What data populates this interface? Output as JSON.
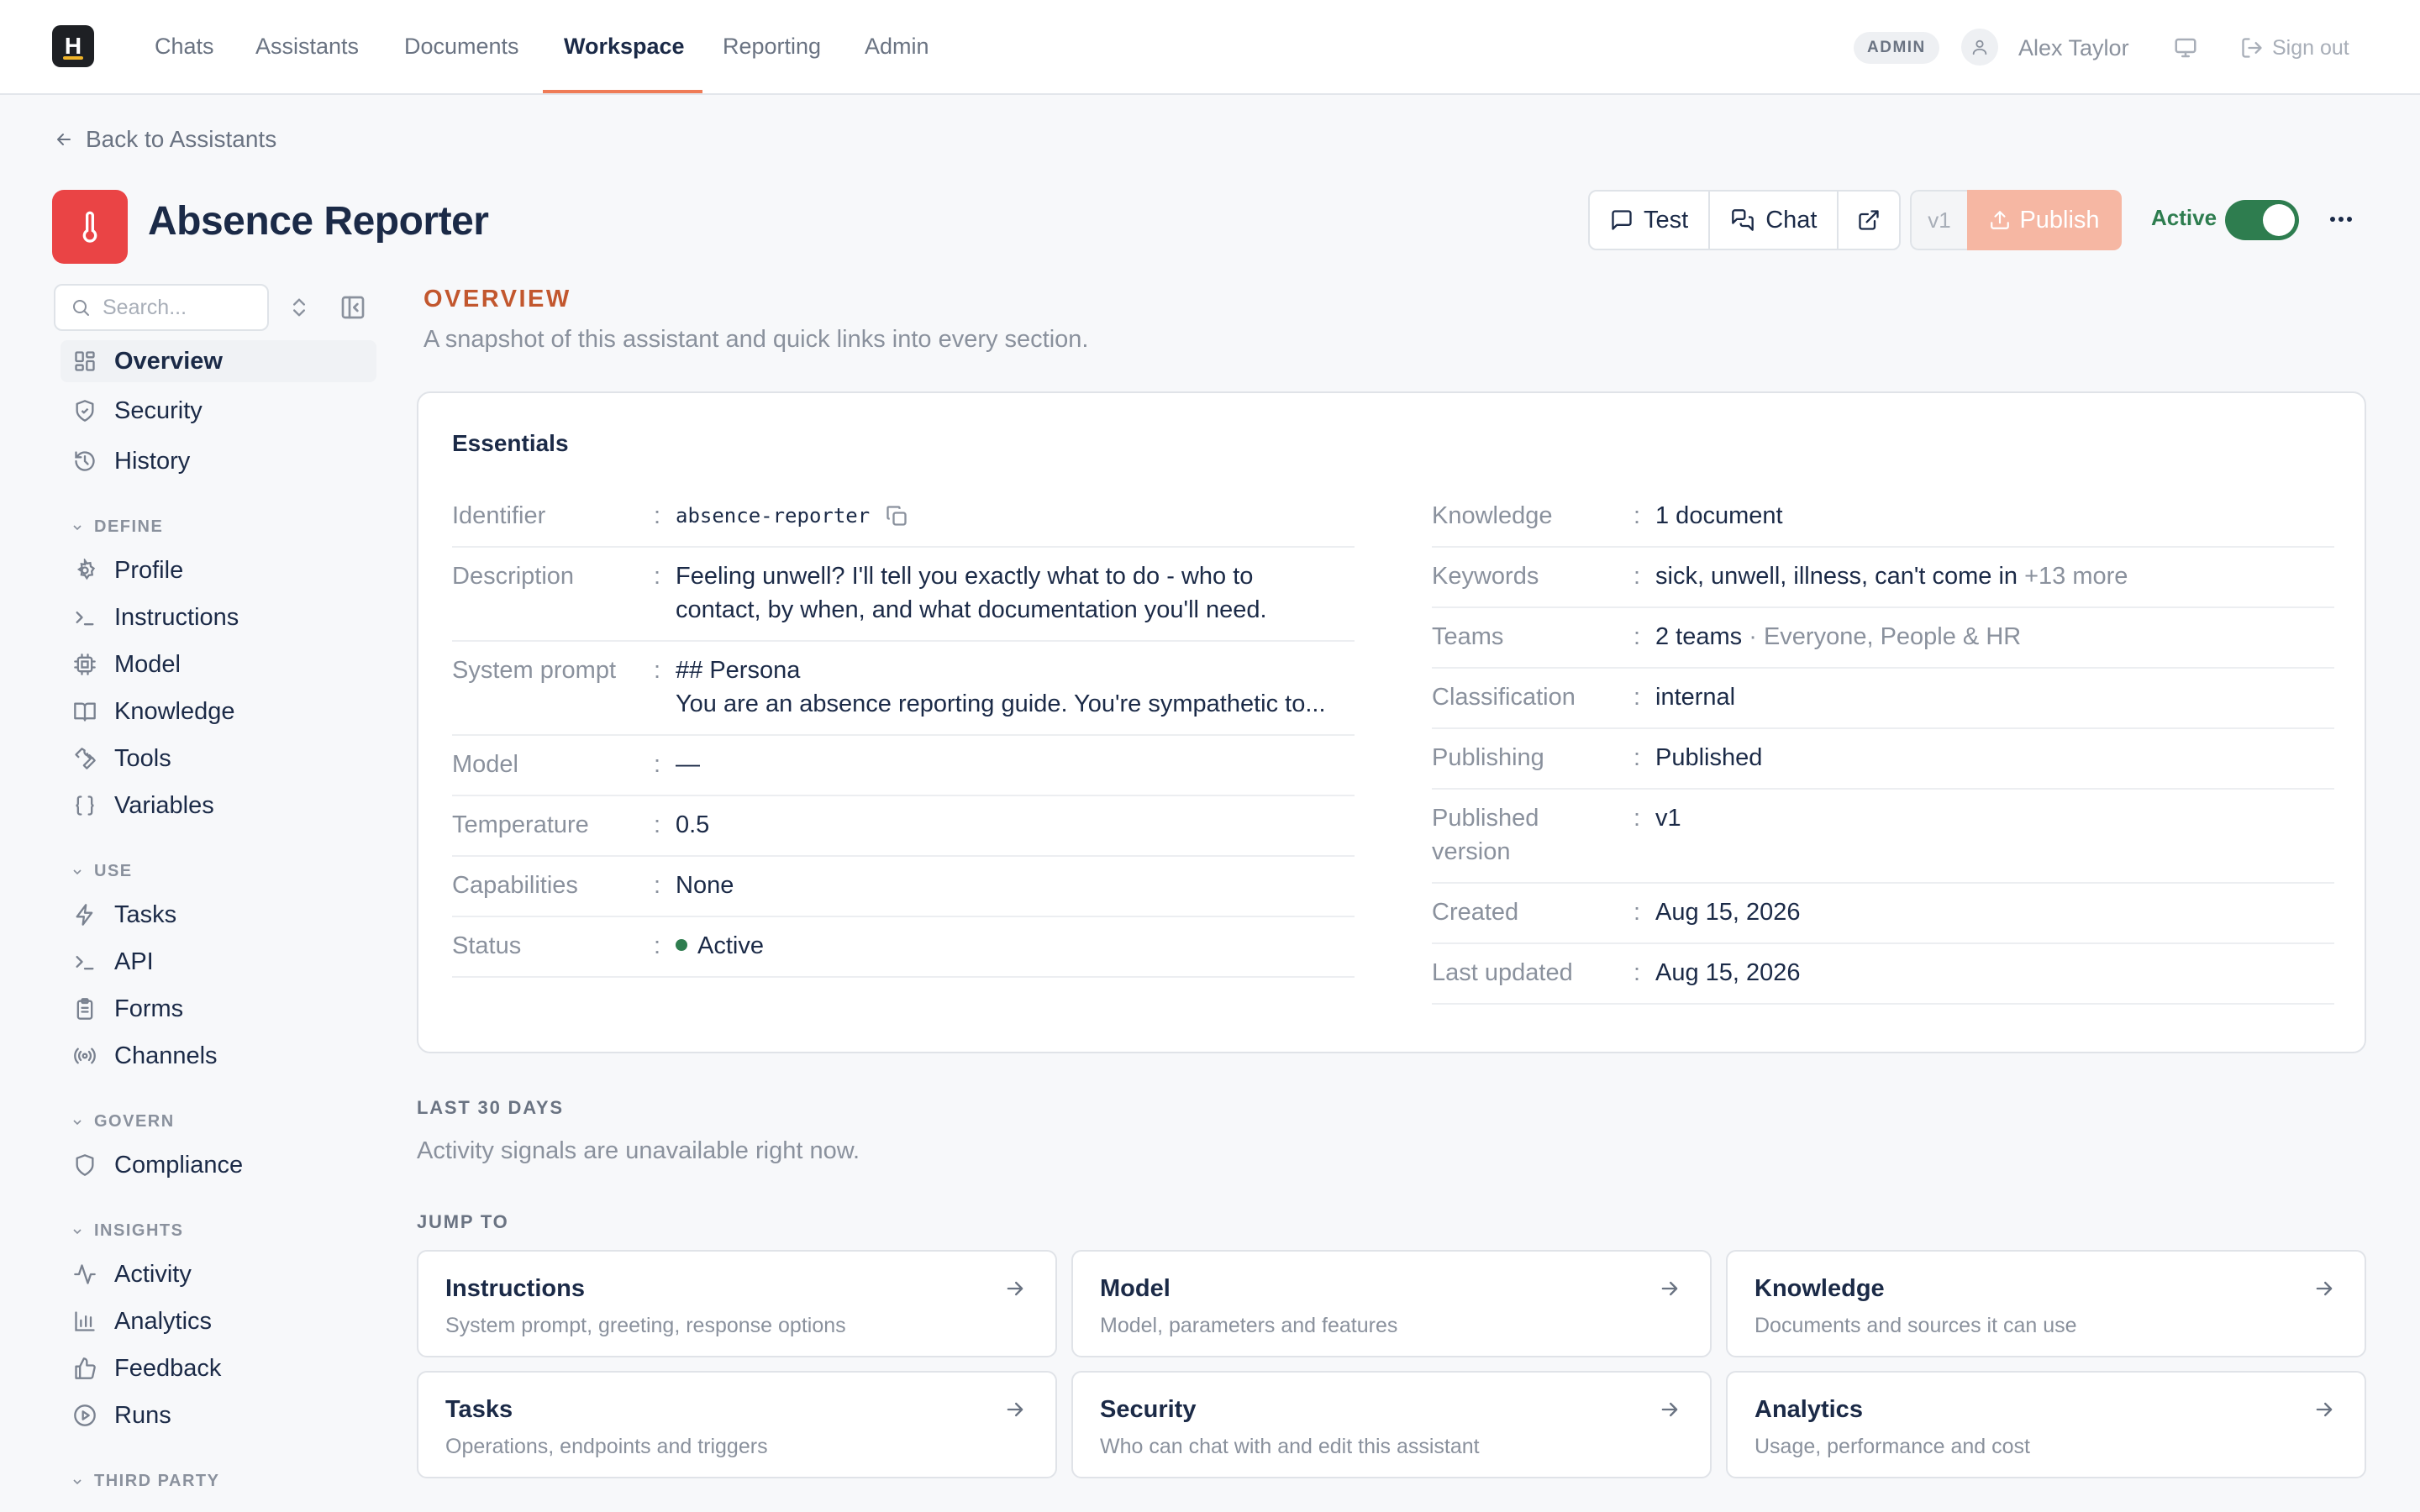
{
  "topnav": {
    "logo_letter": "H",
    "tabs": [
      "Chats",
      "Assistants",
      "Documents",
      "Workspace",
      "Reporting",
      "Admin"
    ],
    "active_tab": "Workspace",
    "role_badge": "ADMIN",
    "user_name": "Alex Taylor",
    "sign_out": "Sign out"
  },
  "back_link": "Back to Assistants",
  "header": {
    "title": "Absence Reporter",
    "icon": "thermometer-icon",
    "icon_color": "#ea4445",
    "test_label": "Test",
    "chat_label": "Chat",
    "version": "v1",
    "publish_label": "Publish",
    "active_label": "Active",
    "active_on": true
  },
  "sidebar": {
    "search_placeholder": "Search...",
    "top_items": [
      {
        "label": "Overview",
        "icon": "grid-icon",
        "active": true
      },
      {
        "label": "Security",
        "icon": "shield-check-icon"
      },
      {
        "label": "History",
        "icon": "history-icon"
      }
    ],
    "sections": [
      {
        "title": "DEFINE",
        "items": [
          {
            "label": "Profile",
            "icon": "gear-icon"
          },
          {
            "label": "Instructions",
            "icon": "terminal-icon"
          },
          {
            "label": "Model",
            "icon": "cpu-icon"
          },
          {
            "label": "Knowledge",
            "icon": "book-icon"
          },
          {
            "label": "Tools",
            "icon": "wrench-icon"
          },
          {
            "label": "Variables",
            "icon": "braces-icon"
          }
        ]
      },
      {
        "title": "USE",
        "items": [
          {
            "label": "Tasks",
            "icon": "lightning-icon"
          },
          {
            "label": "API",
            "icon": "terminal-icon"
          },
          {
            "label": "Forms",
            "icon": "clipboard-icon"
          },
          {
            "label": "Channels",
            "icon": "broadcast-icon"
          }
        ]
      },
      {
        "title": "GOVERN",
        "items": [
          {
            "label": "Compliance",
            "icon": "shield-icon"
          }
        ]
      },
      {
        "title": "INSIGHTS",
        "items": [
          {
            "label": "Activity",
            "icon": "activity-icon"
          },
          {
            "label": "Analytics",
            "icon": "bar-chart-icon"
          },
          {
            "label": "Feedback",
            "icon": "thumbs-up-icon"
          },
          {
            "label": "Runs",
            "icon": "play-circle-icon"
          }
        ]
      },
      {
        "title": "THIRD PARTY",
        "items": []
      }
    ]
  },
  "overview": {
    "eyebrow": "OVERVIEW",
    "subtitle": "A snapshot of this assistant and quick links into every section."
  },
  "essentials": {
    "title": "Essentials",
    "identifier_label": "Identifier",
    "identifier_value": "absence-reporter",
    "left": [
      {
        "label": "Description",
        "value": "Feeling unwell? I'll tell you exactly what to do - who to\ncontact, by when, and what documentation you'll need."
      },
      {
        "label": "System prompt",
        "value": "## Persona\nYou are an absence reporting guide. You're sympathetic to..."
      },
      {
        "label": "Model",
        "value": "—"
      },
      {
        "label": "Temperature",
        "value": "0.5"
      },
      {
        "label": "Capabilities",
        "value": "None"
      }
    ],
    "status_label": "Status",
    "status_value": "Active",
    "right": [
      {
        "label": "Knowledge",
        "value": "1 document",
        "extra": ""
      },
      {
        "label": "Keywords",
        "value": "sick, unwell, illness, can't come in",
        "extra": "+13 more"
      },
      {
        "label": "Teams",
        "value": "2 teams",
        "extra": "· Everyone, People & HR"
      },
      {
        "label": "Classification",
        "value": "internal",
        "extra": ""
      },
      {
        "label": "Publishing",
        "value": "Published",
        "extra": ""
      },
      {
        "label": "Published\nversion",
        "value": "v1",
        "extra": ""
      },
      {
        "label": "Created",
        "value": "Aug 15, 2026",
        "extra": ""
      },
      {
        "label": "Last updated",
        "value": "Aug 15, 2026",
        "extra": ""
      }
    ]
  },
  "activity": {
    "label": "LAST 30 DAYS",
    "note": "Activity signals are unavailable right now."
  },
  "jump_to": {
    "label": "JUMP TO",
    "cards": [
      {
        "title": "Instructions",
        "desc": "System prompt, greeting, response options"
      },
      {
        "title": "Model",
        "desc": "Model, parameters and features"
      },
      {
        "title": "Knowledge",
        "desc": "Documents and sources it can use"
      },
      {
        "title": "Tasks",
        "desc": "Operations, endpoints and triggers"
      },
      {
        "title": "Security",
        "desc": "Who can chat with and edit this assistant"
      },
      {
        "title": "Analytics",
        "desc": "Usage, performance and cost"
      }
    ]
  }
}
